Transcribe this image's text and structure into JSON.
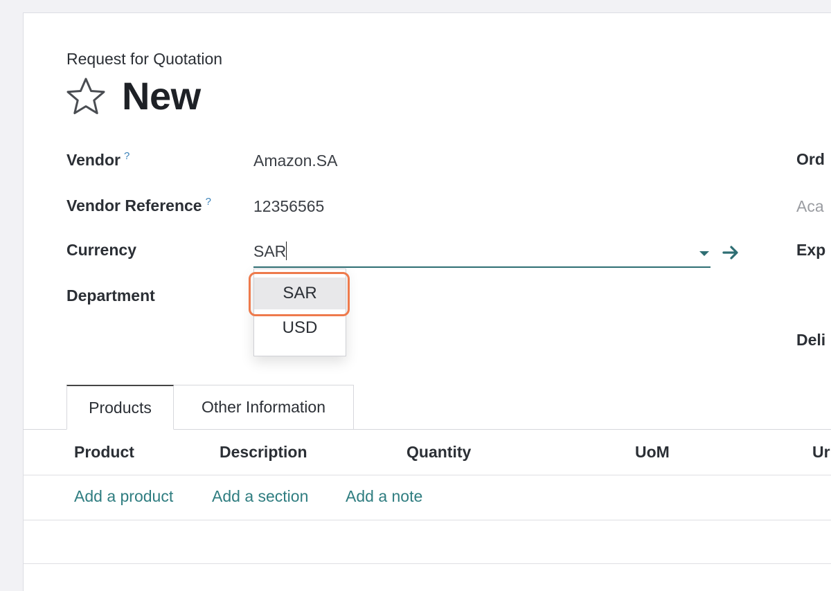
{
  "header": {
    "breadcrumb": "Request for Quotation",
    "title": "New"
  },
  "fields": {
    "vendor": {
      "label": "Vendor",
      "help": "?",
      "value": "Amazon.SA"
    },
    "vendor_reference": {
      "label": "Vendor Reference",
      "help": "?",
      "value": "12356565"
    },
    "currency": {
      "label": "Currency",
      "value": "SAR"
    },
    "department": {
      "label": "Department"
    }
  },
  "right_fields": {
    "order_label": "Ord",
    "acad_value": "Aca",
    "expected_label": "Exp",
    "delivery_label": "Deli"
  },
  "currency_dropdown": {
    "options": [
      "SAR",
      "USD"
    ],
    "selected": "SAR"
  },
  "tabs": [
    {
      "label": "Products",
      "active": true
    },
    {
      "label": "Other Information",
      "active": false
    }
  ],
  "table": {
    "columns": [
      "Product",
      "Description",
      "Quantity",
      "UoM",
      "Ur"
    ],
    "actions": [
      "Add a product",
      "Add a section",
      "Add a note"
    ]
  },
  "colors": {
    "accent": "#2e6e73",
    "link": "#2f7d80",
    "highlight": "#ee7a4c",
    "help": "#3b82b9"
  }
}
